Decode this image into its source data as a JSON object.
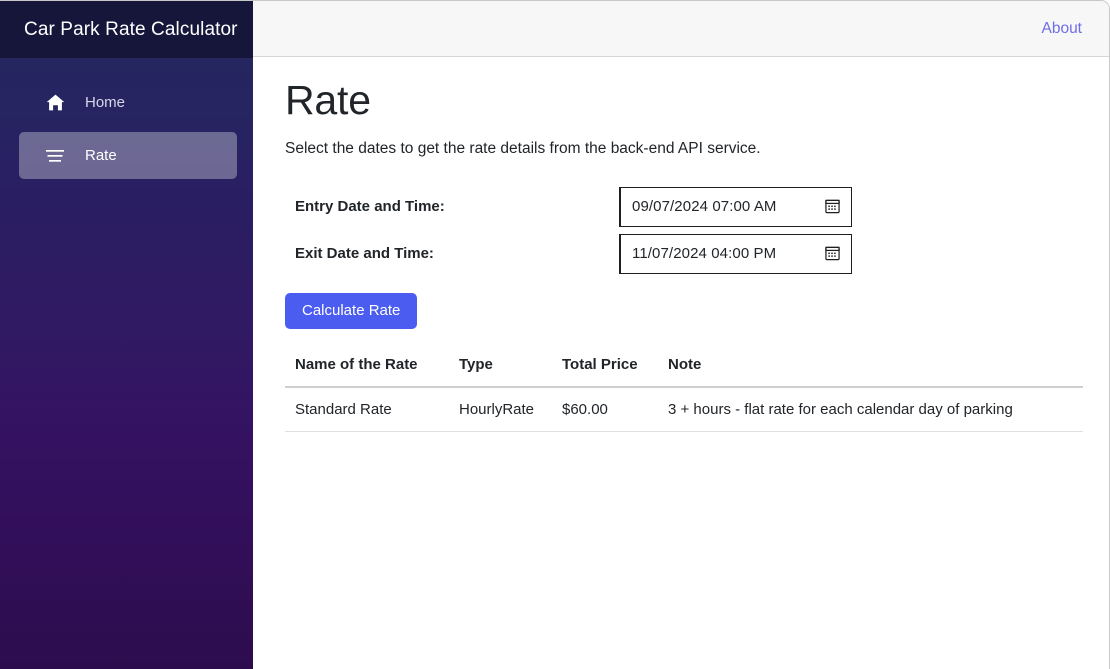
{
  "sidebar": {
    "brand": "Car Park Rate Calculator",
    "items": [
      {
        "label": "Home",
        "icon": "home-icon",
        "active": false
      },
      {
        "label": "Rate",
        "icon": "list-icon",
        "active": true
      }
    ]
  },
  "topbar": {
    "about_label": "About",
    "about_color": "#6e6ee6"
  },
  "main": {
    "title": "Rate",
    "subtitle": "Select the dates to get the rate details from the back-end API service.",
    "form": {
      "entry": {
        "label": "Entry Date and Time:",
        "value": "09/07/2024 07:00 AM",
        "placeholder": "mm/dd/yyyy --:-- --",
        "icon": "calendar-icon"
      },
      "exit": {
        "label": "Exit Date and Time:",
        "value": "11/07/2024 04:00 PM",
        "placeholder": "mm/dd/yyyy --:-- --",
        "icon": "calendar-icon"
      },
      "submit_label": "Calculate Rate",
      "submit_color": "#4b5cf0"
    },
    "table": {
      "headers": [
        "Name of the Rate",
        "Type",
        "Total Price",
        "Note"
      ],
      "rows": [
        {
          "name": "Standard Rate",
          "type": "HourlyRate",
          "price": "$60.00",
          "note": "3 + hours - flat rate for each calendar day of parking"
        }
      ]
    }
  }
}
